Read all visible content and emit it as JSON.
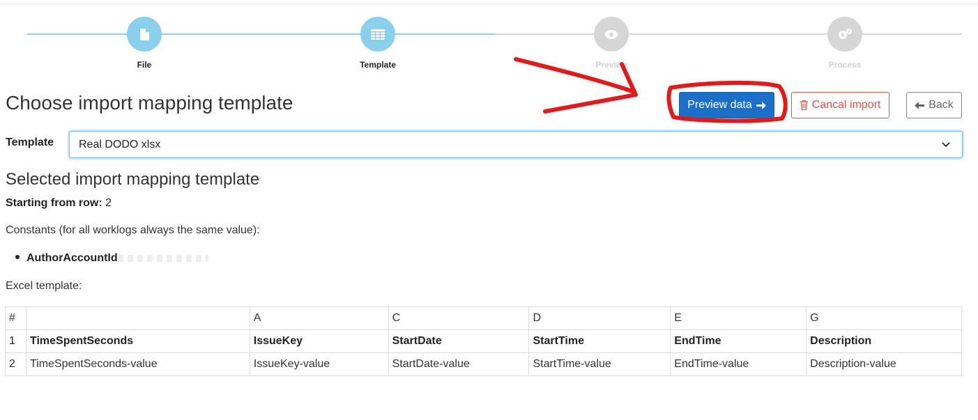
{
  "stepper": {
    "steps": [
      {
        "label": "File",
        "icon": "file-icon",
        "state": "active"
      },
      {
        "label": "Template",
        "icon": "table-icon",
        "state": "active"
      },
      {
        "label": "Preview",
        "icon": "eye-icon",
        "state": "inactive"
      },
      {
        "label": "Process",
        "icon": "gears-icon",
        "state": "inactive"
      }
    ]
  },
  "header": {
    "title": "Choose import mapping template",
    "preview_label": "Preview data",
    "cancel_label": "Cancal import",
    "back_label": "Back"
  },
  "template": {
    "label": "Template",
    "selected": "Real DODO xlsx"
  },
  "selected_section": {
    "title": "Selected import mapping template",
    "starting_label": "Starting from row:",
    "starting_value": "2",
    "constants_text": "Constants (for all worklogs always the same value):",
    "constants": [
      {
        "name": "AuthorAccountId"
      }
    ],
    "excel_label": "Excel template:"
  },
  "excel_table": {
    "columns": [
      "#",
      "",
      "A",
      "C",
      "D",
      "E",
      "G"
    ],
    "rows": [
      [
        "1",
        "TimeSpentSeconds",
        "IssueKey",
        "StartDate",
        "StartTime",
        "EndTime",
        "Description"
      ],
      [
        "2",
        "TimeSpentSeconds-value",
        "IssueKey-value",
        "StartDate-value",
        "StartTime-value",
        "EndTime-value",
        "Description-value"
      ]
    ]
  },
  "colors": {
    "primary": "#1b6fc7",
    "danger": "#d9534f",
    "step_active": "#8ad0ec",
    "step_inactive": "#d6d6d6",
    "annotation": "#e01b1b"
  }
}
